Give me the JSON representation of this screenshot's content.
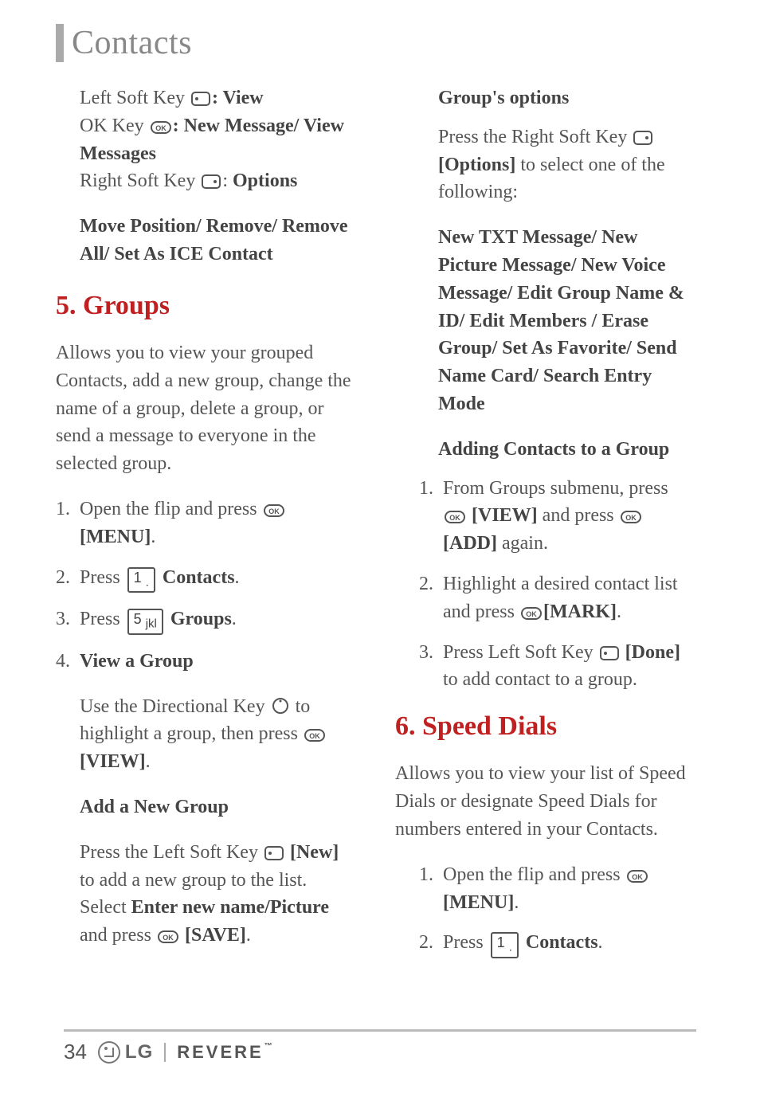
{
  "title": "Contacts",
  "left": {
    "lsk_prefix": "Left Soft Key ",
    "lsk_action": ": View",
    "okk_prefix": "OK Key ",
    "okk_action": ": New Message/ View Messages",
    "rsk_prefix": "Right Soft Key ",
    "rsk_action": ": Options",
    "move_line": "Move Position/ Remove/ Remove All/ Set As ICE Contact",
    "section5": "5. Groups",
    "groups_intro": "Allows you to view your grouped Contacts, add a new group, change the name of a group, delete a group, or send a message to everyone in the selected group.",
    "s5_1_a": "Open the flip and press ",
    "s5_1_b": "[MENU]",
    "s5_1_c": ".",
    "s5_2_a": "Press ",
    "s5_2_key": "1",
    "s5_2_b": "Contacts",
    "s5_2_c": ".",
    "s5_3_a": "Press ",
    "s5_3_key": "5",
    "s5_3_b": "Groups",
    "s5_3_c": ".",
    "s5_4_a": "View a Group",
    "s5_4_use_a": "Use the Directional Key ",
    "s5_4_use_b": " to highlight a group, then press ",
    "s5_4_use_c": "[VIEW]",
    "s5_4_use_d": ".",
    "add_head": "Add a New Group",
    "add_a": "Press the Left Soft Key ",
    "add_b": "[New]",
    "add_c": " to add a new group to the list. Select ",
    "add_d": "Enter new name/Picture",
    "add_e": " and press ",
    "add_f": "[SAVE]",
    "add_g": "."
  },
  "right": {
    "grp_opt_head": "Group's options",
    "grp_opt_a": "Press the Right Soft Key ",
    "grp_opt_b": "[Options]",
    "grp_opt_c": " to select one of the following:",
    "grp_opt_list": "New TXT Message/ New Picture Message/ New Voice Message/ Edit Group Name & ID/ Edit Members / Erase Group/ Set As Favorite/ Send Name Card/ Search Entry Mode",
    "adding_head": "Adding Contacts to a Group",
    "a1_a": "From Groups submenu, press ",
    "a1_b": "[VIEW]",
    "a1_c": " and press ",
    "a1_d": "[ADD]",
    "a1_e": " again.",
    "a2_a": "Highlight a desired contact list and press ",
    "a2_b": "[MARK]",
    "a2_c": ".",
    "a3_a": "Press Left Soft Key ",
    "a3_b": "[Done]",
    "a3_c": " to add contact to a group.",
    "section6": "6. Speed Dials",
    "sd_intro": "Allows you to view your list of Speed Dials or designate Speed Dials for numbers entered in your Contacts.",
    "sd1_a": "Open the flip and press ",
    "sd1_b": "[MENU]",
    "sd1_c": ".",
    "sd2_a": "Press ",
    "sd2_key": "1",
    "sd2_b": "Contacts",
    "sd2_c": "."
  },
  "footer": {
    "page": "34",
    "lg": "LG",
    "product": "REVERE"
  },
  "nums": {
    "n1": "1.",
    "n2": "2.",
    "n3": "3.",
    "n4": "4."
  }
}
